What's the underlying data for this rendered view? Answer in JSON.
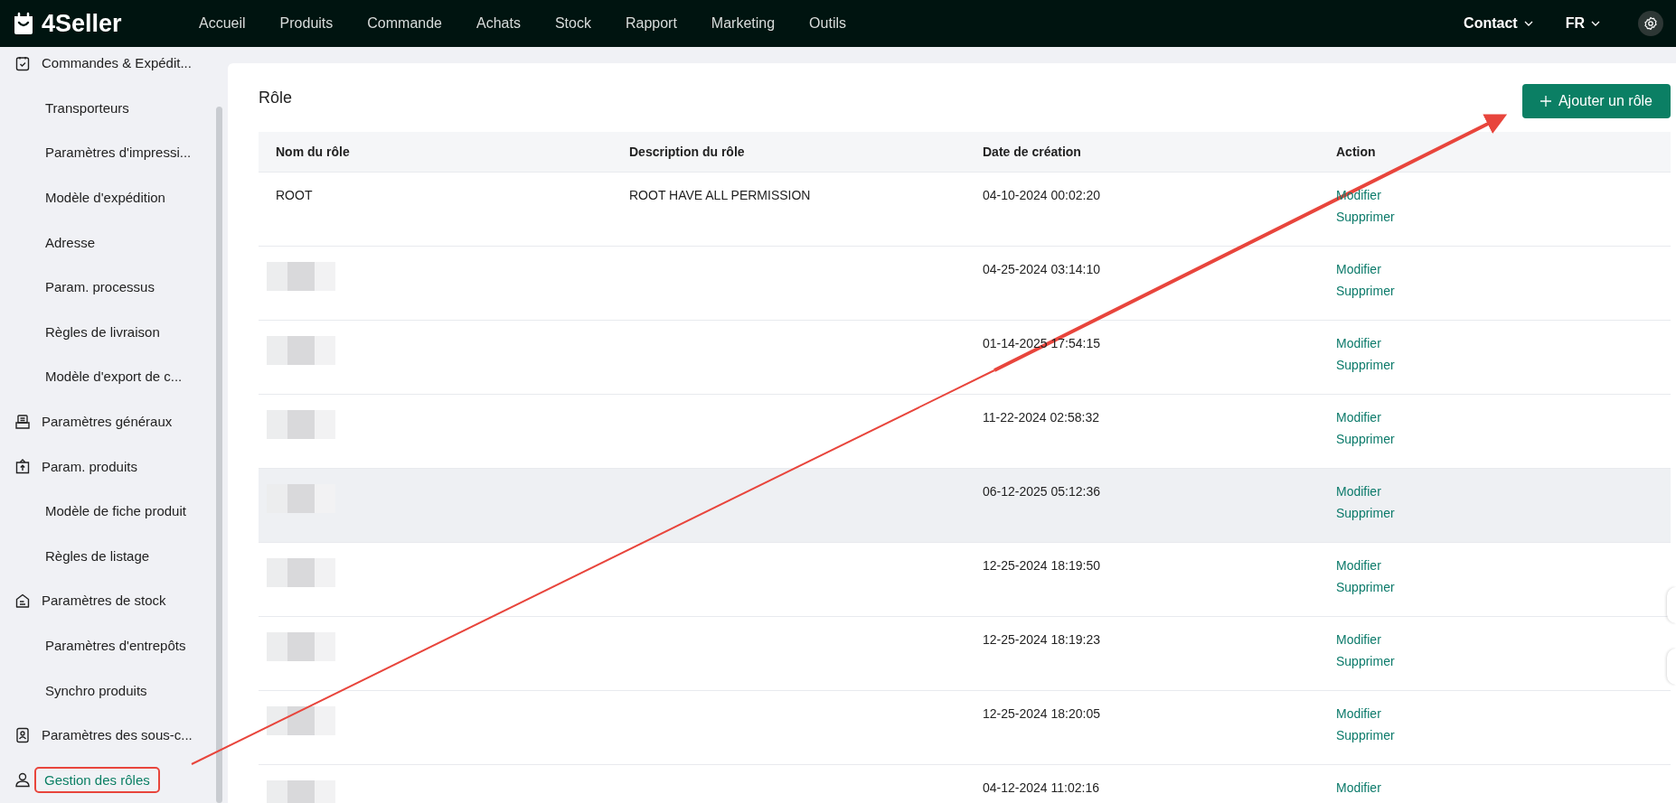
{
  "topbar": {
    "logo": "4Seller",
    "nav": [
      {
        "label": "Accueil"
      },
      {
        "label": "Produits"
      },
      {
        "label": "Commande"
      },
      {
        "label": "Achats"
      },
      {
        "label": "Stock"
      },
      {
        "label": "Rapport"
      },
      {
        "label": "Marketing"
      },
      {
        "label": "Outils"
      }
    ],
    "contact": "Contact",
    "language": "FR"
  },
  "sidebar": {
    "items": [
      {
        "label": "Commandes & Expédit...",
        "selected": false,
        "annotated": false,
        "children": [
          {
            "label": "Transporteurs",
            "selected": false,
            "annotated": false
          },
          {
            "label": "Paramètres d'impressi...",
            "selected": false,
            "annotated": false
          },
          {
            "label": "Modèle d'expédition",
            "selected": false,
            "annotated": false
          },
          {
            "label": "Adresse",
            "selected": false,
            "annotated": false
          },
          {
            "label": "Param. processus",
            "selected": false,
            "annotated": false
          },
          {
            "label": "Règles de livraison",
            "selected": false,
            "annotated": false
          },
          {
            "label": "Modèle d'export de c...",
            "selected": false,
            "annotated": false
          }
        ]
      },
      {
        "label": "Paramètres généraux",
        "selected": false,
        "annotated": false
      },
      {
        "label": "Param. produits",
        "selected": false,
        "annotated": false,
        "children": [
          {
            "label": "Modèle de fiche produit",
            "selected": false,
            "annotated": false
          },
          {
            "label": "Règles de listage",
            "selected": false,
            "annotated": false
          }
        ]
      },
      {
        "label": "Paramètres de stock",
        "selected": false,
        "annotated": false,
        "children": [
          {
            "label": "Paramètres d'entrepôts",
            "selected": false,
            "annotated": false
          },
          {
            "label": "Synchro produits",
            "selected": false,
            "annotated": false
          }
        ]
      },
      {
        "label": "Paramètres des sous-c...",
        "selected": false,
        "annotated": false
      },
      {
        "label": "Gestion des rôles",
        "selected": true,
        "annotated": true
      }
    ]
  },
  "page": {
    "title": "Rôle",
    "add_button": "Ajouter un rôle",
    "annotation_arrow": true
  },
  "table": {
    "columns": [
      "Nom du rôle",
      "Description du rôle",
      "Date de création",
      "Action"
    ],
    "rows": [
      {
        "name": "ROOT",
        "name_hidden": false,
        "description": "ROOT HAVE ALL PERMISSION",
        "created": "04-10-2024 00:02:20",
        "actions": [
          "Modifier",
          "Supprimer"
        ],
        "highlighted": false
      },
      {
        "name_hidden": true,
        "created": "04-25-2024 03:14:10",
        "actions": [
          "Modifier",
          "Supprimer"
        ],
        "highlighted": false
      },
      {
        "name_hidden": true,
        "created": "01-14-2025 17:54:15",
        "actions": [
          "Modifier",
          "Supprimer"
        ],
        "highlighted": false
      },
      {
        "name_hidden": true,
        "created": "11-22-2024 02:58:32",
        "actions": [
          "Modifier",
          "Supprimer"
        ],
        "highlighted": false
      },
      {
        "name_hidden": true,
        "created": "06-12-2025 05:12:36",
        "actions": [
          "Modifier",
          "Supprimer"
        ],
        "highlighted": true
      },
      {
        "name_hidden": true,
        "created": "12-25-2024 18:19:50",
        "actions": [
          "Modifier",
          "Supprimer"
        ],
        "highlighted": false
      },
      {
        "name_hidden": true,
        "created": "12-25-2024 18:19:23",
        "actions": [
          "Modifier",
          "Supprimer"
        ],
        "highlighted": false
      },
      {
        "name_hidden": true,
        "created": "12-25-2024 18:20:05",
        "actions": [
          "Modifier",
          "Supprimer"
        ],
        "highlighted": false
      },
      {
        "name_hidden": true,
        "created": "04-12-2024 11:02:16",
        "actions": [
          "Modifier"
        ],
        "highlighted": false
      }
    ]
  }
}
